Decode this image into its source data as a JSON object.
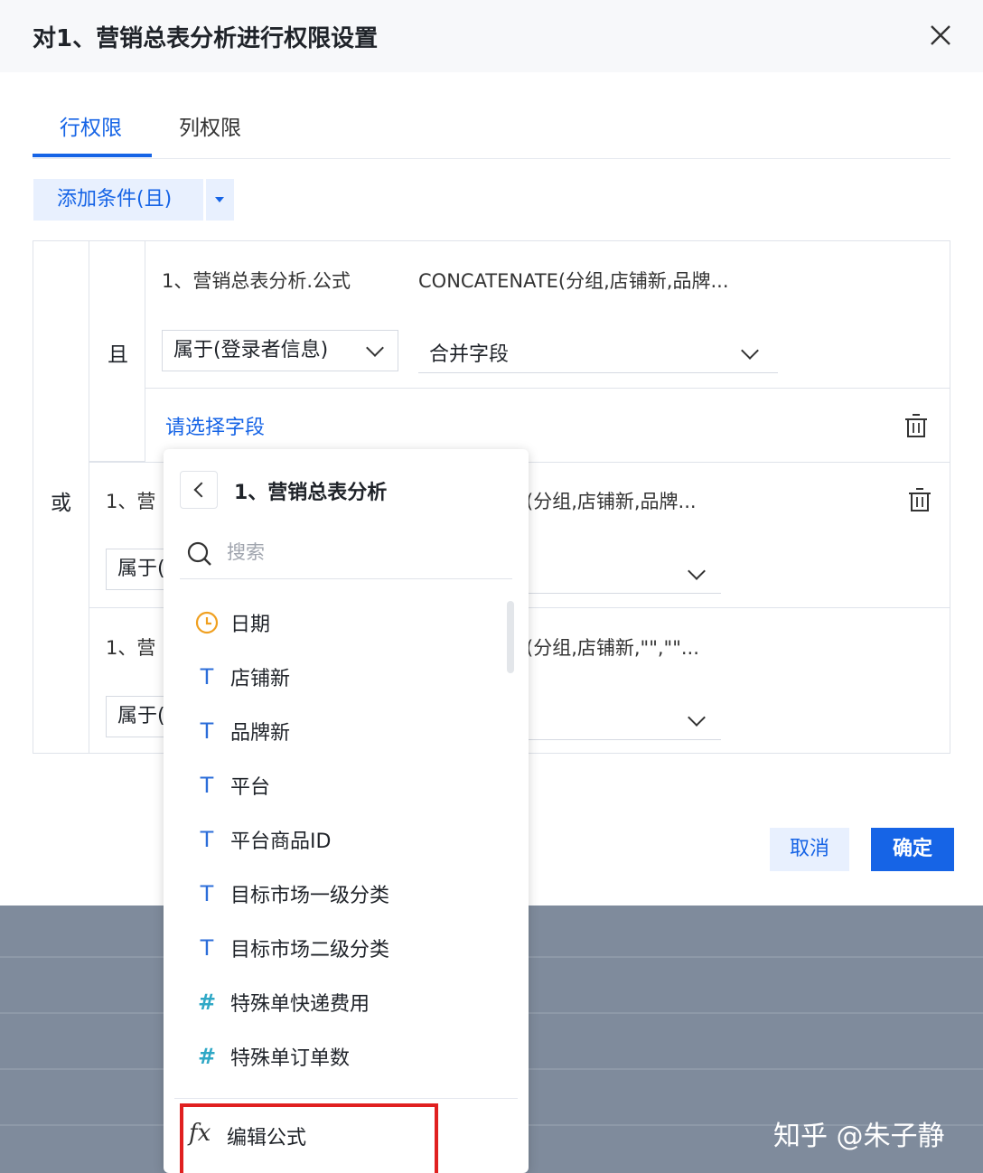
{
  "dialog": {
    "title": "对1、营销总表分析进行权限设置",
    "tabs": [
      {
        "label": "行权限",
        "active": true
      },
      {
        "label": "列权限",
        "active": false
      }
    ],
    "add_condition_label": "添加条件(且)",
    "or_label": "或",
    "and_label": "且",
    "rule1": {
      "field": "1、营销总表分析.公式",
      "value": "CONCATENATE(分组,店铺新,品牌...",
      "operator": "属于(登录者信息)",
      "target": "合并字段",
      "select_field_link": "请选择字段"
    },
    "rule2": {
      "field": "1、营",
      "value": "(分组,店铺新,品牌...",
      "operator": "属于("
    },
    "rule3": {
      "field": "1、营",
      "value": "(分组,店铺新,\"\",\"\"...",
      "operator": "属于("
    },
    "cancel_label": "取消",
    "ok_label": "确定"
  },
  "popup": {
    "title": "1、营销总表分析",
    "search_placeholder": "搜索",
    "fields": [
      {
        "icon": "clock-icon",
        "type": "date",
        "label": "日期"
      },
      {
        "icon": "text-type-icon",
        "type": "text",
        "label": "店铺新"
      },
      {
        "icon": "text-type-icon",
        "type": "text",
        "label": "品牌新"
      },
      {
        "icon": "text-type-icon",
        "type": "text",
        "label": "平台"
      },
      {
        "icon": "text-type-icon",
        "type": "text",
        "label": "平台商品ID"
      },
      {
        "icon": "text-type-icon",
        "type": "text",
        "label": "目标市场一级分类"
      },
      {
        "icon": "text-type-icon",
        "type": "text",
        "label": "目标市场二级分类"
      },
      {
        "icon": "number-type-icon",
        "type": "number",
        "label": "特殊单快递费用"
      },
      {
        "icon": "number-type-icon",
        "type": "number",
        "label": "特殊单订单数"
      }
    ],
    "formula_label": "编辑公式",
    "formula_icon_text": "fx"
  },
  "watermark": "知乎 @朱子静",
  "colors": {
    "accent": "#1664e6",
    "highlight": "#e02020",
    "overlay": "#7f8b9c"
  }
}
